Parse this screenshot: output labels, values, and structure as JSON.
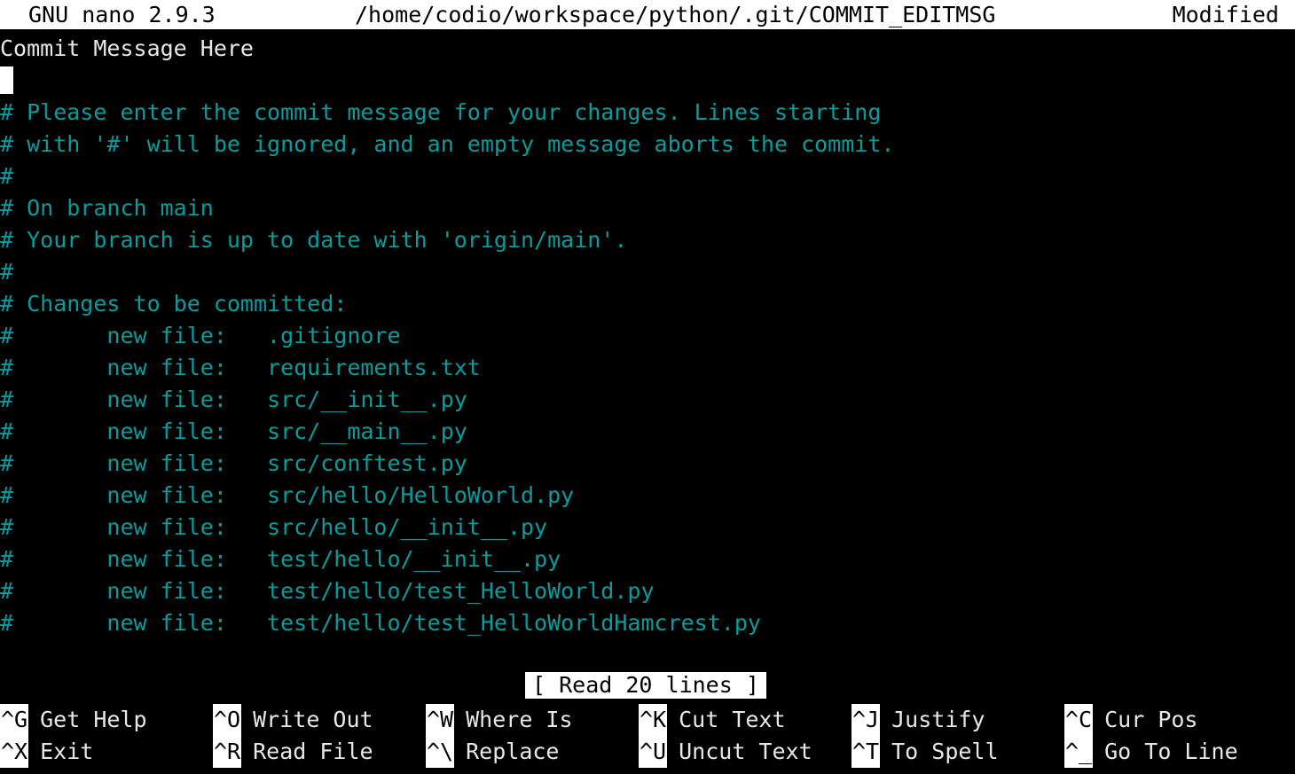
{
  "titlebar": {
    "version": "GNU nano 2.9.3",
    "filename": "/home/codio/workspace/python/.git/COMMIT_EDITMSG",
    "state": "Modified"
  },
  "editor": {
    "lines": [
      {
        "text": "Commit Message Here",
        "kind": "plain"
      },
      {
        "text": "",
        "kind": "plain"
      },
      {
        "text": "# Please enter the commit message for your changes. Lines starting",
        "kind": "comment"
      },
      {
        "text": "# with '#' will be ignored, and an empty message aborts the commit.",
        "kind": "comment"
      },
      {
        "text": "#",
        "kind": "comment"
      },
      {
        "text": "# On branch main",
        "kind": "comment"
      },
      {
        "text": "# Your branch is up to date with 'origin/main'.",
        "kind": "comment"
      },
      {
        "text": "#",
        "kind": "comment"
      },
      {
        "text": "# Changes to be committed:",
        "kind": "comment"
      },
      {
        "text": "#       new file:   .gitignore",
        "kind": "comment"
      },
      {
        "text": "#       new file:   requirements.txt",
        "kind": "comment"
      },
      {
        "text": "#       new file:   src/__init__.py",
        "kind": "comment"
      },
      {
        "text": "#       new file:   src/__main__.py",
        "kind": "comment"
      },
      {
        "text": "#       new file:   src/conftest.py",
        "kind": "comment"
      },
      {
        "text": "#       new file:   src/hello/HelloWorld.py",
        "kind": "comment"
      },
      {
        "text": "#       new file:   src/hello/__init__.py",
        "kind": "comment"
      },
      {
        "text": "#       new file:   test/hello/__init__.py",
        "kind": "comment"
      },
      {
        "text": "#       new file:   test/hello/test_HelloWorld.py",
        "kind": "comment"
      },
      {
        "text": "#       new file:   test/hello/test_HelloWorldHamcrest.py",
        "kind": "comment"
      }
    ],
    "cursor": {
      "line": 1,
      "column": 0
    }
  },
  "status": {
    "message": "[ Read 20 lines ]"
  },
  "keybar": {
    "entries": [
      {
        "combo": "^G",
        "label": "Get Help",
        "col": 0,
        "row": 0
      },
      {
        "combo": "^X",
        "label": "Exit",
        "col": 0,
        "row": 1
      },
      {
        "combo": "^O",
        "label": "Write Out",
        "col": 1,
        "row": 0
      },
      {
        "combo": "^R",
        "label": "Read File",
        "col": 1,
        "row": 1
      },
      {
        "combo": "^W",
        "label": "Where Is",
        "col": 2,
        "row": 0
      },
      {
        "combo": "^\\",
        "label": "Replace",
        "col": 2,
        "row": 1
      },
      {
        "combo": "^K",
        "label": "Cut Text",
        "col": 3,
        "row": 0
      },
      {
        "combo": "^U",
        "label": "Uncut Text",
        "col": 3,
        "row": 1
      },
      {
        "combo": "^J",
        "label": "Justify",
        "col": 4,
        "row": 0
      },
      {
        "combo": "^T",
        "label": "To Spell",
        "col": 4,
        "row": 1
      },
      {
        "combo": "^C",
        "label": "Cur Pos",
        "col": 5,
        "row": 0
      },
      {
        "combo": "^_",
        "label": "Go To Line",
        "col": 5,
        "row": 1
      }
    ]
  },
  "colors": {
    "background": "#000000",
    "foreground": "#e8e8e8",
    "comment": "#0a9c9c",
    "inverse_bg": "#ffffff",
    "inverse_fg": "#000000"
  }
}
